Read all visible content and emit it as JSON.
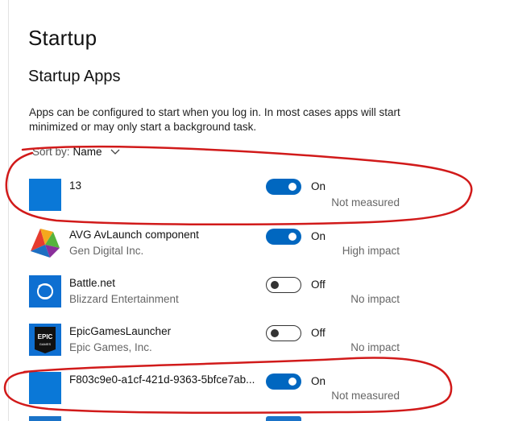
{
  "page": {
    "title": "Startup",
    "subtitle": "Startup Apps"
  },
  "description": "Apps can be configured to start when you log in. In most cases apps will start minimized or may only start a background task.",
  "sort": {
    "label": "Sort by:",
    "value": "Name"
  },
  "colors": {
    "accent": "#0067c0",
    "annotation": "#d11a1a"
  },
  "apps": [
    {
      "name": "13",
      "publisher": "",
      "state": "On",
      "impact": "Not measured",
      "icon": "blank-tile-icon"
    },
    {
      "name": "AVG AvLaunch component",
      "publisher": "Gen Digital Inc.",
      "state": "On",
      "impact": "High impact",
      "icon": "avg-logo-icon"
    },
    {
      "name": "Battle.net",
      "publisher": "Blizzard Entertainment",
      "state": "Off",
      "impact": "No impact",
      "icon": "battlenet-icon"
    },
    {
      "name": "EpicGamesLauncher",
      "publisher": "Epic Games, Inc.",
      "state": "Off",
      "impact": "No impact",
      "icon": "epic-games-icon"
    },
    {
      "name": "F803c9e0-a1cf-421d-9363-5bfce7ab...",
      "publisher": "",
      "state": "On",
      "impact": "Not measured",
      "icon": "blank-tile-icon"
    }
  ]
}
